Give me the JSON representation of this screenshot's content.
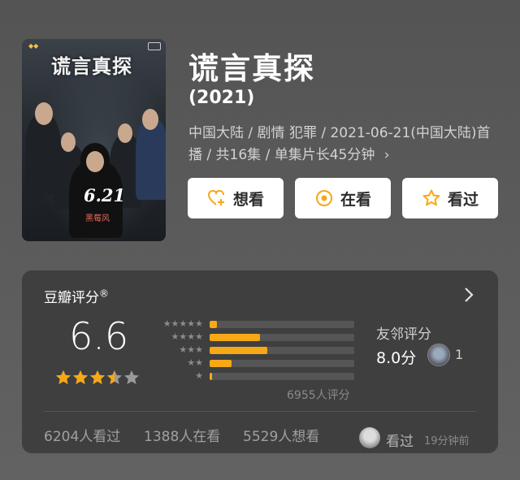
{
  "poster": {
    "title_text": "谎言真探",
    "date_text": "6.21",
    "sub_text": "黑莓风"
  },
  "movie": {
    "title": "谎言真探",
    "year": "(2021)",
    "meta_line": "中国大陆 / 剧情 犯罪 / 2021-06-21(中国大陆)首播 / 共16集 / 单集片长45分钟",
    "chevron": "›"
  },
  "actions": {
    "want": "想看",
    "watching": "在看",
    "watched": "看过"
  },
  "rating": {
    "header": "豆瓣评分",
    "registered": "®",
    "score": "6.6",
    "stars_value": 3.5,
    "distribution": [
      {
        "stars": "★★★★★",
        "percent": 5
      },
      {
        "stars": "★★★★",
        "percent": 35
      },
      {
        "stars": "★★★",
        "percent": 40
      },
      {
        "stars": "★★",
        "percent": 15
      },
      {
        "stars": "★",
        "percent": 1
      }
    ],
    "count_text": "6955人评分",
    "friends_label": "友邻评分",
    "friends_score": "8.0分",
    "friends_count": "1"
  },
  "stats": {
    "watched": "6204人看过",
    "watching": "1388人在看",
    "want": "5529人想看"
  },
  "my_mark": {
    "status": "看过",
    "time": "19分钟前"
  },
  "colors": {
    "accent": "#f7a816",
    "background": "#575757",
    "card": "#3f3f3f"
  }
}
